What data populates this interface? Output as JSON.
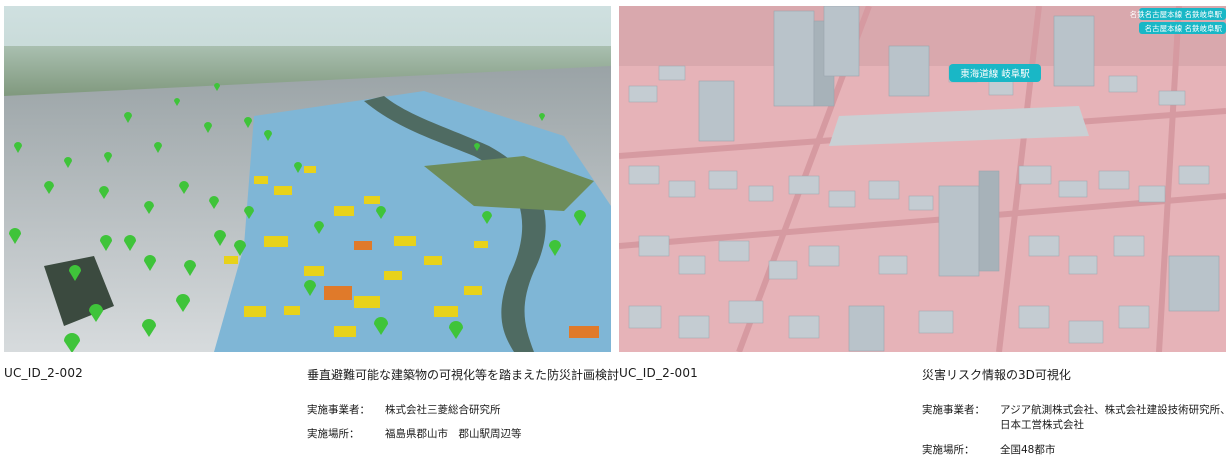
{
  "cards": [
    {
      "id": "UC_ID_2-002",
      "title": "垂直避難可能な建築物の可視化等を踏まえた防災計画検討",
      "operator_label": "実施事業者：",
      "operator": "株式会社三菱総合研究所",
      "place_label": "実施場所：",
      "place": "福島県郡山市　郡山駅周辺等"
    },
    {
      "id": "UC_ID_2-001",
      "title": "災害リスク情報の3D可視化",
      "operator_label": "実施事業者：",
      "operator_line1": "アジア航測株式会社、株式会社建設技術研究所、",
      "operator_line2": "日本工営株式会社",
      "place_label": "実施場所：",
      "place": "全国48都市",
      "map_labels": {
        "station": "東海道線 岐阜駅",
        "corner1": "名鉄名古屋本線 名鉄岐阜駅",
        "corner2": "名古屋本線 名鉄岐阜駅"
      }
    }
  ],
  "colors": {
    "flood": "#7fb6d6",
    "marker": "#3fc43a",
    "building_risk": "#e8d21a",
    "risk_zone": "#e6b3b8",
    "building_gray": "#b9c3ca",
    "label_bg": "#19b7c6"
  }
}
